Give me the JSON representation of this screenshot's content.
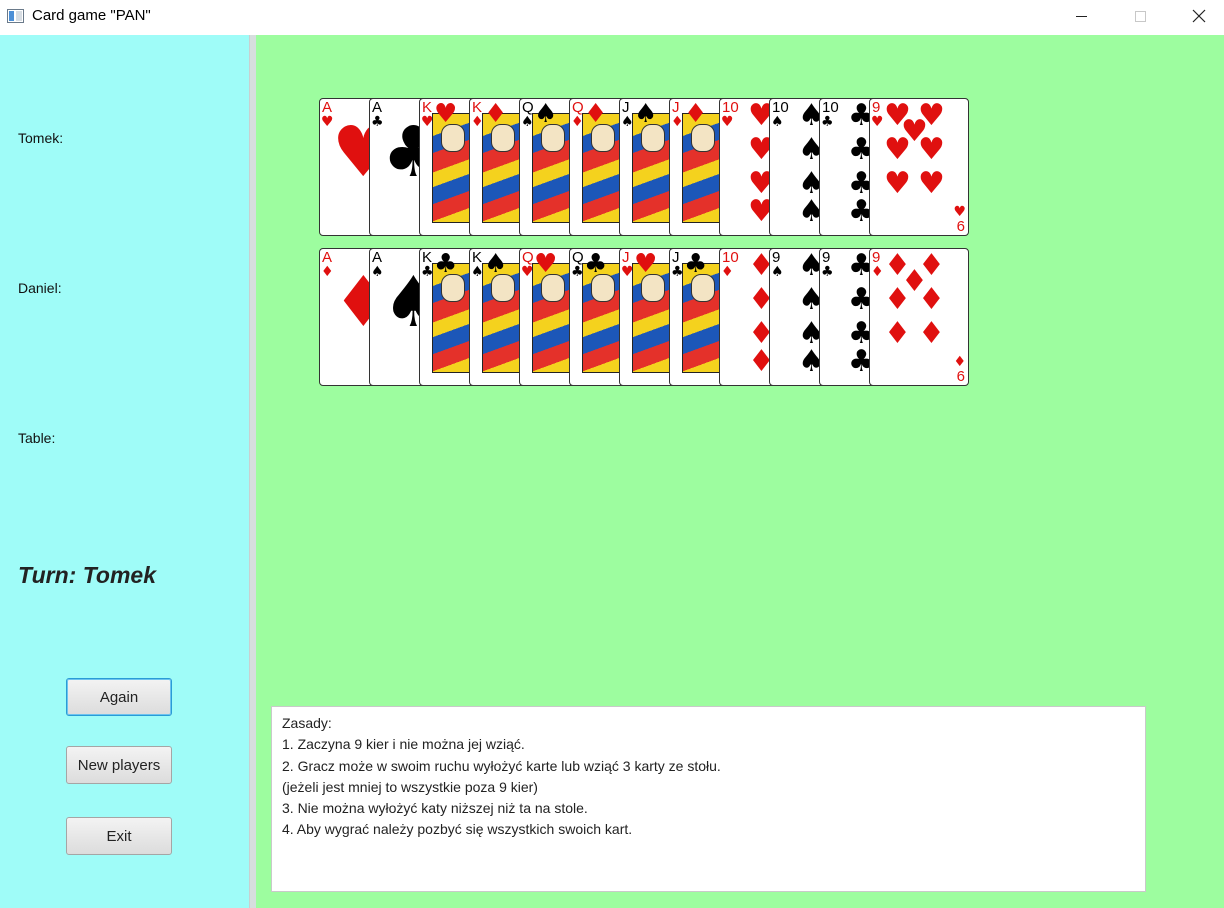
{
  "window": {
    "title": "Card game \"PAN\""
  },
  "sidebar": {
    "players": [
      {
        "label": "Tomek:"
      },
      {
        "label": "Daniel:"
      },
      {
        "label": "Table:"
      }
    ],
    "turn": "Turn: Tomek",
    "buttons": {
      "again": "Again",
      "new_players": "New players",
      "exit": "Exit"
    }
  },
  "hands": [
    {
      "cards": [
        {
          "rank": "A",
          "suit": "♥",
          "color": "#e0100f",
          "kind": "ace"
        },
        {
          "rank": "A",
          "suit": "♣",
          "color": "#000000",
          "kind": "ace"
        },
        {
          "rank": "K",
          "suit": "♥",
          "color": "#e0100f",
          "kind": "face"
        },
        {
          "rank": "K",
          "suit": "♦",
          "color": "#e0100f",
          "kind": "face"
        },
        {
          "rank": "Q",
          "suit": "♠",
          "color": "#000000",
          "kind": "face"
        },
        {
          "rank": "Q",
          "suit": "♦",
          "color": "#e0100f",
          "kind": "face"
        },
        {
          "rank": "J",
          "suit": "♠",
          "color": "#000000",
          "kind": "face"
        },
        {
          "rank": "J",
          "suit": "♦",
          "color": "#e0100f",
          "kind": "face"
        },
        {
          "rank": "10",
          "suit": "♥",
          "color": "#e0100f",
          "kind": "pips"
        },
        {
          "rank": "10",
          "suit": "♠",
          "color": "#000000",
          "kind": "pips"
        },
        {
          "rank": "10",
          "suit": "♣",
          "color": "#000000",
          "kind": "pips"
        },
        {
          "rank": "9",
          "suit": "♥",
          "color": "#e0100f",
          "kind": "last",
          "corner": "6"
        }
      ]
    },
    {
      "cards": [
        {
          "rank": "A",
          "suit": "♦",
          "color": "#e0100f",
          "kind": "ace"
        },
        {
          "rank": "A",
          "suit": "♠",
          "color": "#000000",
          "kind": "ace"
        },
        {
          "rank": "K",
          "suit": "♣",
          "color": "#000000",
          "kind": "face"
        },
        {
          "rank": "K",
          "suit": "♠",
          "color": "#000000",
          "kind": "face"
        },
        {
          "rank": "Q",
          "suit": "♥",
          "color": "#e0100f",
          "kind": "face"
        },
        {
          "rank": "Q",
          "suit": "♣",
          "color": "#000000",
          "kind": "face"
        },
        {
          "rank": "J",
          "suit": "♥",
          "color": "#e0100f",
          "kind": "face"
        },
        {
          "rank": "J",
          "suit": "♣",
          "color": "#000000",
          "kind": "face"
        },
        {
          "rank": "10",
          "suit": "♦",
          "color": "#e0100f",
          "kind": "pips"
        },
        {
          "rank": "9",
          "suit": "♠",
          "color": "#000000",
          "kind": "pips"
        },
        {
          "rank": "9",
          "suit": "♣",
          "color": "#000000",
          "kind": "pips"
        },
        {
          "rank": "9",
          "suit": "♦",
          "color": "#e0100f",
          "kind": "last",
          "corner": "6"
        }
      ]
    }
  ],
  "rules": {
    "lines": [
      "Zasady:",
      "1. Zaczyna 9 kier i nie można jej wziąć.",
      "2. Gracz może w swoim ruchu wyłożyć karte lub wziąć 3 karty ze stołu.",
      "(jeżeli jest mniej to wszystkie poza 9 kier)",
      "3. Nie można wyłożyć katy niższej niż ta na stole.",
      "4. Aby wygrać należy pozbyć się wszystkich swoich kart."
    ]
  }
}
